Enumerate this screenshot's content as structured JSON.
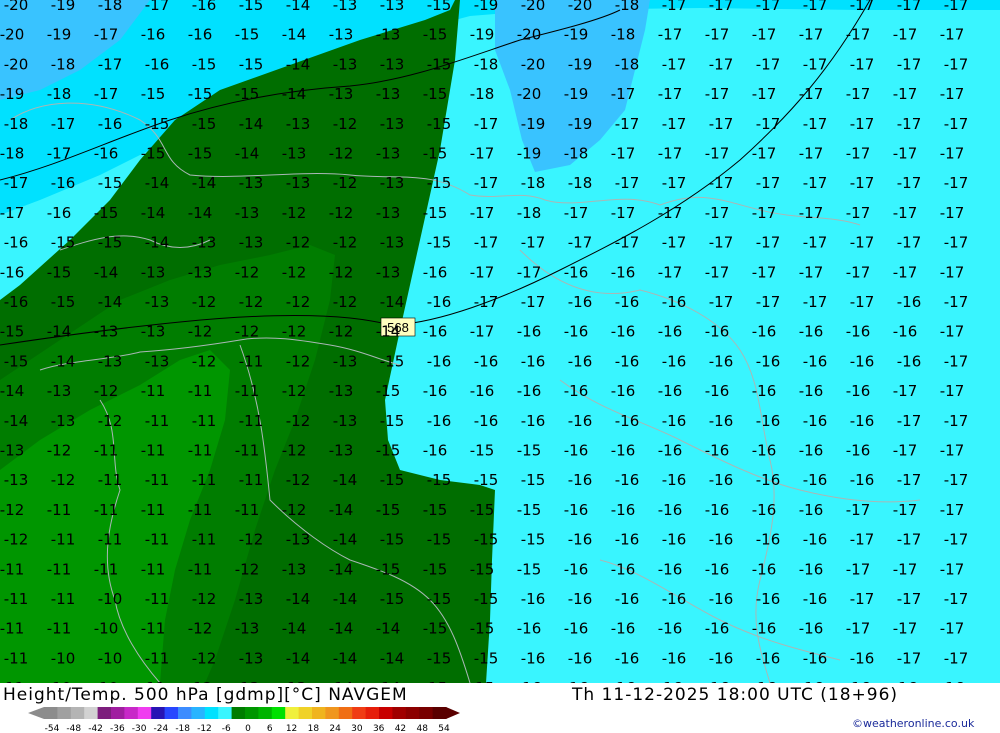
{
  "map": {
    "isoline_label": "568",
    "field_colors": {
      "cyan_light": "#39f5ff",
      "cyan_mid": "#00e1ff",
      "blue_cold": "#39c3ff",
      "green_dark": "#006e00",
      "green_mid": "#007d00",
      "green_light": "#009600"
    },
    "temperature_rows": [
      {
        "row": 0,
        "values": [
          "-20",
          "-19",
          "-18",
          "-17",
          "-16",
          "-15",
          "-14",
          "-13",
          "-13",
          "-15",
          "-19",
          "-20",
          "-20",
          "-18",
          "-17",
          "-17",
          "-17",
          "-17",
          "-17",
          "-17",
          "-17",
          "-17"
        ]
      },
      {
        "row": 1,
        "values": [
          "-20",
          "-19",
          "-17",
          "-16",
          "-16",
          "-15",
          "-14",
          "-13",
          "-13",
          "-15",
          "-19",
          "-20",
          "-19",
          "-18",
          "-17",
          "-17",
          "-17",
          "-17",
          "-17",
          "-17",
          "-17",
          "-17"
        ]
      },
      {
        "row": 2,
        "values": [
          "-20",
          "-18",
          "-17",
          "-16",
          "-15",
          "-15",
          "-14",
          "-13",
          "-13",
          "-15",
          "-18",
          "-20",
          "-19",
          "-18",
          "-17",
          "-17",
          "-17",
          "-17",
          "-17",
          "-17",
          "-17",
          "-17"
        ]
      },
      {
        "row": 3,
        "values": [
          "-19",
          "-18",
          "-17",
          "-15",
          "-15",
          "-15",
          "-14",
          "-13",
          "-13",
          "-15",
          "-18",
          "-20",
          "-19",
          "-17",
          "-17",
          "-17",
          "-17",
          "-17",
          "-17",
          "-17",
          "-17",
          "-17"
        ]
      },
      {
        "row": 4,
        "values": [
          "-18",
          "-17",
          "-16",
          "-15",
          "-15",
          "-14",
          "-13",
          "-12",
          "-13",
          "-15",
          "-17",
          "-19",
          "-19",
          "-17",
          "-17",
          "-17",
          "-17",
          "-17",
          "-17",
          "-17",
          "-17",
          "-17"
        ]
      },
      {
        "row": 5,
        "values": [
          "-18",
          "-17",
          "-16",
          "-15",
          "-15",
          "-14",
          "-13",
          "-12",
          "-13",
          "-15",
          "-17",
          "-19",
          "-18",
          "-17",
          "-17",
          "-17",
          "-17",
          "-17",
          "-17",
          "-17",
          "-17",
          "-17"
        ]
      },
      {
        "row": 6,
        "values": [
          "-17",
          "-16",
          "-15",
          "-14",
          "-14",
          "-13",
          "-13",
          "-12",
          "-13",
          "-15",
          "-17",
          "-18",
          "-18",
          "-17",
          "-17",
          "-17",
          "-17",
          "-17",
          "-17",
          "-17",
          "-17",
          "-17"
        ]
      },
      {
        "row": 7,
        "values": [
          "-17",
          "-16",
          "-15",
          "-14",
          "-14",
          "-13",
          "-12",
          "-12",
          "-13",
          "-15",
          "-17",
          "-18",
          "-17",
          "-17",
          "-17",
          "-17",
          "-17",
          "-17",
          "-17",
          "-17",
          "-17",
          "-17"
        ]
      },
      {
        "row": 8,
        "values": [
          "-16",
          "-15",
          "-15",
          "-14",
          "-13",
          "-13",
          "-12",
          "-12",
          "-13",
          "-15",
          "-17",
          "-17",
          "-17",
          "-17",
          "-17",
          "-17",
          "-17",
          "-17",
          "-17",
          "-17",
          "-17",
          "-17"
        ]
      },
      {
        "row": 9,
        "values": [
          "-16",
          "-15",
          "-14",
          "-13",
          "-13",
          "-12",
          "-12",
          "-12",
          "-13",
          "-16",
          "-17",
          "-17",
          "-16",
          "-16",
          "-17",
          "-17",
          "-17",
          "-17",
          "-17",
          "-17",
          "-17",
          "-17"
        ]
      },
      {
        "row": 10,
        "values": [
          "-16",
          "-15",
          "-14",
          "-13",
          "-12",
          "-12",
          "-12",
          "-12",
          "-14",
          "-16",
          "-17",
          "-17",
          "-16",
          "-16",
          "-16",
          "-17",
          "-17",
          "-17",
          "-17",
          "-16",
          "-17",
          "-17"
        ]
      },
      {
        "row": 11,
        "values": [
          "-15",
          "-14",
          "-13",
          "-13",
          "-12",
          "-12",
          "-12",
          "-12",
          "-14",
          "-16",
          "-17",
          "-16",
          "-16",
          "-16",
          "-16",
          "-16",
          "-16",
          "-16",
          "-16",
          "-16",
          "-17",
          "-17"
        ]
      },
      {
        "row": 12,
        "values": [
          "-15",
          "-14",
          "-13",
          "-13",
          "-12",
          "-11",
          "-12",
          "-13",
          "-15",
          "-16",
          "-16",
          "-16",
          "-16",
          "-16",
          "-16",
          "-16",
          "-16",
          "-16",
          "-16",
          "-16",
          "-17",
          "-17"
        ]
      },
      {
        "row": 13,
        "values": [
          "-14",
          "-13",
          "-12",
          "-11",
          "-11",
          "-11",
          "-12",
          "-13",
          "-15",
          "-16",
          "-16",
          "-16",
          "-16",
          "-16",
          "-16",
          "-16",
          "-16",
          "-16",
          "-16",
          "-17",
          "-17",
          "-17"
        ]
      },
      {
        "row": 14,
        "values": [
          "-14",
          "-13",
          "-12",
          "-11",
          "-11",
          "-11",
          "-12",
          "-13",
          "-15",
          "-16",
          "-16",
          "-16",
          "-16",
          "-16",
          "-16",
          "-16",
          "-16",
          "-16",
          "-16",
          "-17",
          "-17",
          "-17"
        ]
      },
      {
        "row": 15,
        "values": [
          "-13",
          "-12",
          "-11",
          "-11",
          "-11",
          "-11",
          "-12",
          "-13",
          "-15",
          "-16",
          "-15",
          "-15",
          "-16",
          "-16",
          "-16",
          "-16",
          "-16",
          "-16",
          "-16",
          "-17",
          "-17",
          "-17"
        ]
      },
      {
        "row": 16,
        "values": [
          "-13",
          "-12",
          "-11",
          "-11",
          "-11",
          "-11",
          "-12",
          "-14",
          "-15",
          "-15",
          "-15",
          "-15",
          "-16",
          "-16",
          "-16",
          "-16",
          "-16",
          "-16",
          "-16",
          "-17",
          "-17",
          "-17"
        ]
      },
      {
        "row": 17,
        "values": [
          "-12",
          "-11",
          "-11",
          "-11",
          "-11",
          "-11",
          "-12",
          "-14",
          "-15",
          "-15",
          "-15",
          "-15",
          "-16",
          "-16",
          "-16",
          "-16",
          "-16",
          "-16",
          "-17",
          "-17",
          "-17",
          "-17"
        ]
      },
      {
        "row": 18,
        "values": [
          "-12",
          "-11",
          "-11",
          "-11",
          "-11",
          "-12",
          "-13",
          "-14",
          "-15",
          "-15",
          "-15",
          "-15",
          "-16",
          "-16",
          "-16",
          "-16",
          "-16",
          "-16",
          "-17",
          "-17",
          "-17",
          "-17"
        ]
      },
      {
        "row": 19,
        "values": [
          "-11",
          "-11",
          "-11",
          "-11",
          "-11",
          "-12",
          "-13",
          "-14",
          "-15",
          "-15",
          "-15",
          "-15",
          "-16",
          "-16",
          "-16",
          "-16",
          "-16",
          "-16",
          "-17",
          "-17",
          "-17",
          "-17"
        ]
      },
      {
        "row": 20,
        "values": [
          "-11",
          "-11",
          "-10",
          "-11",
          "-12",
          "-13",
          "-14",
          "-14",
          "-15",
          "-15",
          "-15",
          "-16",
          "-16",
          "-16",
          "-16",
          "-16",
          "-16",
          "-16",
          "-17",
          "-17",
          "-17",
          "-17"
        ]
      },
      {
        "row": 21,
        "values": [
          "-11",
          "-11",
          "-10",
          "-11",
          "-12",
          "-13",
          "-14",
          "-14",
          "-14",
          "-15",
          "-15",
          "-16",
          "-16",
          "-16",
          "-16",
          "-16",
          "-16",
          "-16",
          "-17",
          "-17",
          "-17",
          "-17"
        ]
      },
      {
        "row": 22,
        "values": [
          "-11",
          "-10",
          "-10",
          "-11",
          "-12",
          "-13",
          "-14",
          "-14",
          "-14",
          "-15",
          "-15",
          "-16",
          "-16",
          "-16",
          "-16",
          "-16",
          "-16",
          "-16",
          "-16",
          "-17",
          "-17",
          "-17"
        ]
      },
      {
        "row": 23,
        "values": [
          "-11",
          "-10",
          "-10",
          "-11",
          "-12",
          "-13",
          "-13",
          "-14",
          "-14",
          "-15",
          "-15",
          "-16",
          "-16",
          "-16",
          "-16",
          "-16",
          "-16",
          "-16",
          "-16",
          "-16",
          "-16",
          "-16"
        ]
      },
      {
        "row": 24,
        "values": [
          "-10",
          "-10",
          "-10",
          "-11",
          "-12",
          "-13",
          "-13",
          "-14",
          "-14",
          "-15",
          "-15",
          "-16",
          "-16",
          "-16",
          "-16",
          "-16",
          "-16",
          "-16",
          "-16",
          "-16",
          "-16",
          "-16"
        ]
      }
    ]
  },
  "footer": {
    "title": "Height/Temp. 500 hPa [gdmp][°C] NAVGEM",
    "datetime": "Th 11-12-2025 18:00 UTC (18+96)",
    "credit": "©weatheronline.co.uk"
  },
  "legend": {
    "ticks": [
      "-54",
      "-48",
      "-42",
      "-36",
      "-30",
      "-24",
      "-18",
      "-12",
      "-6",
      "0",
      "6",
      "12",
      "18",
      "24",
      "30",
      "36",
      "42",
      "48",
      "54"
    ],
    "colors": [
      "#8c8c8c",
      "#a0a0a0",
      "#b4b4b4",
      "#d2d2d2",
      "#7d1e7d",
      "#a01ea0",
      "#c828c8",
      "#f03cf0",
      "#2814b4",
      "#2846ff",
      "#3c8cff",
      "#28b4ff",
      "#00e1ff",
      "#39f5ff",
      "#007d00",
      "#009600",
      "#00b400",
      "#00e100",
      "#f0f03c",
      "#f0d228",
      "#f0b41e",
      "#f0961e",
      "#f06e14",
      "#f03c14",
      "#e61e0a",
      "#c80000",
      "#a00000",
      "#8c0000",
      "#780000",
      "#5a0000"
    ]
  }
}
